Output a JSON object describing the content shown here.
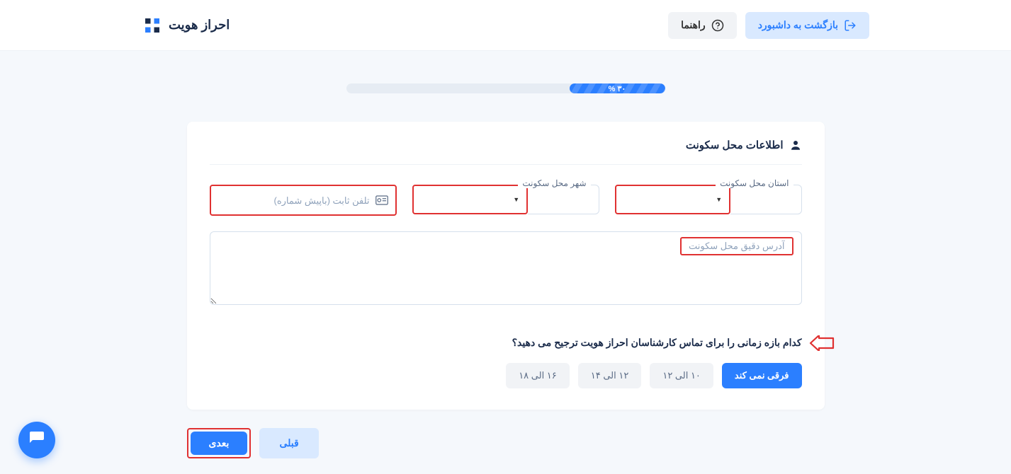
{
  "header": {
    "brand": "احراز هویت",
    "back_to_dashboard": "بازگشت به داشبورد",
    "help": "راهنما"
  },
  "progress": {
    "percent_label": "۳۰ %"
  },
  "card": {
    "title": "اطلاعات محل سکونت",
    "province_label": "استان محل سکونت",
    "city_label": "شهر محل سکونت",
    "phone_placeholder": "تلفن ثابت (باپیش شماره)",
    "address_placeholder": "آدرس دقیق محل سکونت"
  },
  "question": {
    "text": "کدام بازه زمانی را برای تماس کارشناسان احراز هویت ترجیح می دهید؟"
  },
  "options": {
    "any": "فرقی نمی کند",
    "slot1": "۱۰ الی ۱۲",
    "slot2": "۱۲ الی ۱۴",
    "slot3": "۱۶ الی ۱۸"
  },
  "nav": {
    "prev": "قبلی",
    "next": "بعدی"
  }
}
